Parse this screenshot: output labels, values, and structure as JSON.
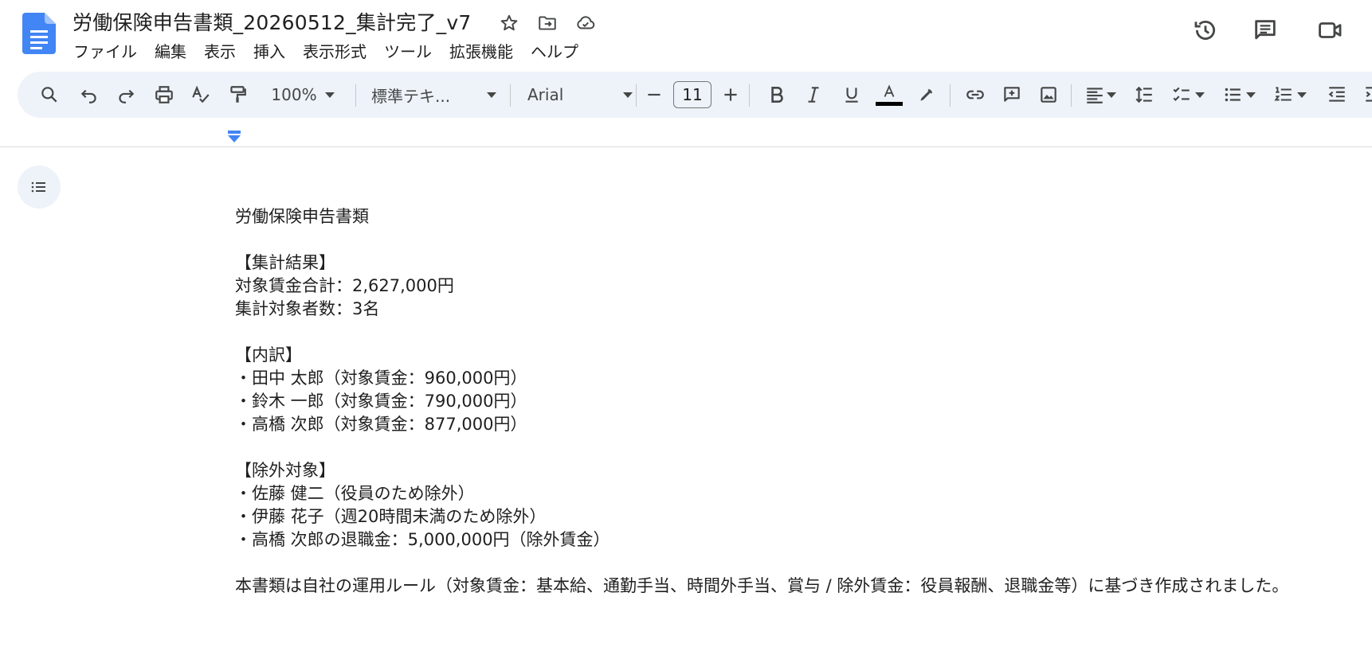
{
  "document": {
    "title": "労働保険申告書類_20260512_集計完了_v7"
  },
  "menu": {
    "items": [
      "ファイル",
      "編集",
      "表示",
      "挿入",
      "表示形式",
      "ツール",
      "拡張機能",
      "ヘルプ"
    ]
  },
  "toolbar": {
    "zoom": "100%",
    "style": "標準テキ...",
    "font": "Arial",
    "font_size": "11"
  },
  "icons": {
    "title_bar": [
      "star-icon",
      "move-to-folder-icon",
      "cloud-saved-icon"
    ],
    "top_right": [
      "version-history-icon",
      "comments-icon",
      "meet-icon"
    ]
  },
  "colors": {
    "docs_blue": "#4285f4",
    "toolbar_bg": "#eef2f9",
    "text_color_bar": "#000000"
  },
  "body": {
    "lines": [
      "労働保険申告書類",
      "",
      "【集計結果】",
      "対象賃金合計：2,627,000円",
      "集計対象者数：3名",
      "",
      "【内訳】",
      "・田中 太郎（対象賃金：960,000円）",
      "・鈴木 一郎（対象賃金：790,000円）",
      "・高橋 次郎（対象賃金：877,000円）",
      "",
      "【除外対象】",
      "・佐藤 健二（役員のため除外）",
      "・伊藤 花子（週20時間未満のため除外）",
      "・高橋 次郎の退職金：5,000,000円（除外賃金）",
      "",
      "本書類は自社の運用ルール（対象賃金：基本給、通勤手当、時間外手当、賞与 / 除外賃金：役員報酬、退職金等）に基づき作成されました。"
    ]
  }
}
